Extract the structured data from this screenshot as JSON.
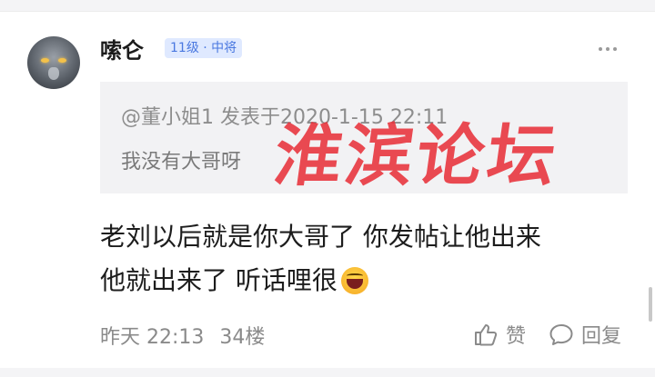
{
  "post": {
    "username": "嗦仑",
    "level": "11级 · 中将",
    "quote": {
      "meta": "@董小姐1 发表于2020-1-15 22:11",
      "text": "我没有大哥呀"
    },
    "watermark": "淮滨论坛",
    "body_line1": "老刘以后就是你大哥了   你发帖让他出来",
    "body_line2": "他就出来了 听话哩很",
    "time": "昨天 22:13",
    "floor": "34楼",
    "like_label": "赞",
    "reply_label": "回复",
    "icons": [
      "more-icon",
      "thumbs-up-icon",
      "comment-icon",
      "grin-emoji-icon"
    ]
  }
}
